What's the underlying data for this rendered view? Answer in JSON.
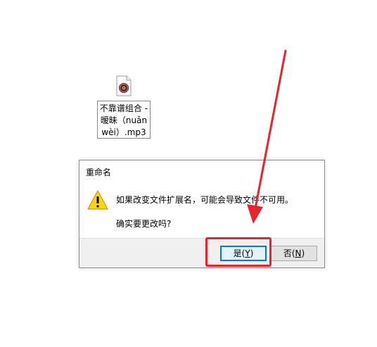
{
  "desktop_file": {
    "icon": "audio-file-icon",
    "label_lines": [
      "不靠谱组合 -",
      "暧昧（nuǎn",
      "wèi）.mp3"
    ]
  },
  "dialog": {
    "title": "重命名",
    "icon": "warning-icon",
    "message": "如果改变文件扩展名，可能会导致文件不可用。",
    "question": "确实要更改吗?",
    "yes_label_main": "是(",
    "yes_hotkey": "Y",
    "yes_label_end": ")",
    "no_label_main": "否(",
    "no_hotkey": "N",
    "no_label_end": ")"
  },
  "annotation": {
    "color": "#e4262b",
    "type": "red-arrow-and-box-highlighting-yes-button"
  }
}
